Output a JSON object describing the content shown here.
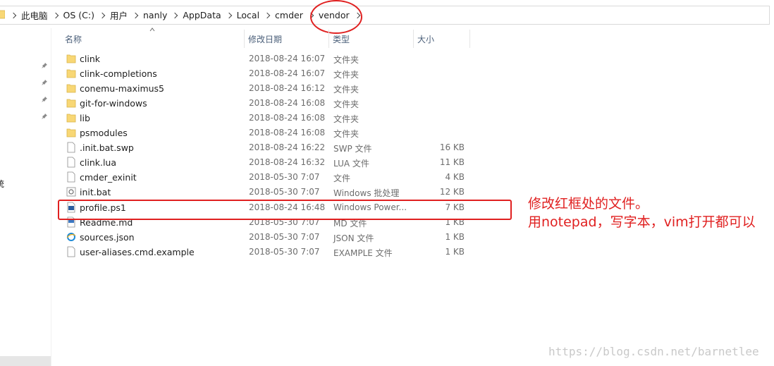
{
  "address_bar": {
    "crumbs": [
      "此电脑",
      "OS (C:)",
      "用户",
      "nanly",
      "AppData",
      "Local",
      "cmder",
      "vendor"
    ]
  },
  "nav_pane": {
    "partial_label": "统"
  },
  "columns": {
    "name": "名称",
    "date": "修改日期",
    "type": "类型",
    "size": "大小"
  },
  "files": [
    {
      "name": "clink",
      "date": "2018-08-24 16:07",
      "type": "文件夹",
      "size": "",
      "icon": "folder-icon"
    },
    {
      "name": "clink-completions",
      "date": "2018-08-24 16:07",
      "type": "文件夹",
      "size": "",
      "icon": "folder-icon"
    },
    {
      "name": "conemu-maximus5",
      "date": "2018-08-24 16:12",
      "type": "文件夹",
      "size": "",
      "icon": "folder-icon"
    },
    {
      "name": "git-for-windows",
      "date": "2018-08-24 16:08",
      "type": "文件夹",
      "size": "",
      "icon": "folder-icon"
    },
    {
      "name": "lib",
      "date": "2018-08-24 16:08",
      "type": "文件夹",
      "size": "",
      "icon": "folder-icon"
    },
    {
      "name": "psmodules",
      "date": "2018-08-24 16:08",
      "type": "文件夹",
      "size": "",
      "icon": "folder-icon"
    },
    {
      "name": ".init.bat.swp",
      "date": "2018-08-24 16:22",
      "type": "SWP 文件",
      "size": "16 KB",
      "icon": "file-icon"
    },
    {
      "name": "clink.lua",
      "date": "2018-08-24 16:32",
      "type": "LUA 文件",
      "size": "11 KB",
      "icon": "file-icon"
    },
    {
      "name": "cmder_exinit",
      "date": "2018-05-30 7:07",
      "type": "文件",
      "size": "4 KB",
      "icon": "file-icon"
    },
    {
      "name": "init.bat",
      "date": "2018-05-30 7:07",
      "type": "Windows 批处理",
      "size": "12 KB",
      "icon": "batch-file-icon"
    },
    {
      "name": "profile.ps1",
      "date": "2018-08-24 16:48",
      "type": "Windows Power...",
      "size": "7 KB",
      "icon": "powershell-file-icon"
    },
    {
      "name": "Readme.md",
      "date": "2018-05-30 7:07",
      "type": "MD 文件",
      "size": "1 KB",
      "icon": "markdown-file-icon"
    },
    {
      "name": "sources.json",
      "date": "2018-05-30 7:07",
      "type": "JSON 文件",
      "size": "1 KB",
      "icon": "ie-file-icon"
    },
    {
      "name": "user-aliases.cmd.example",
      "date": "2018-05-30 7:07",
      "type": "EXAMPLE 文件",
      "size": "1 KB",
      "icon": "file-icon"
    }
  ],
  "annotation": {
    "line1": "修改红框处的文件。",
    "line2": "用notepad，写字本，vim打开都可以"
  },
  "watermark": "https://blog.csdn.net/barnetlee",
  "colors": {
    "annotation_red": "#e02020",
    "folder_yellow": "#f8d775",
    "header_text": "#4c607a"
  }
}
